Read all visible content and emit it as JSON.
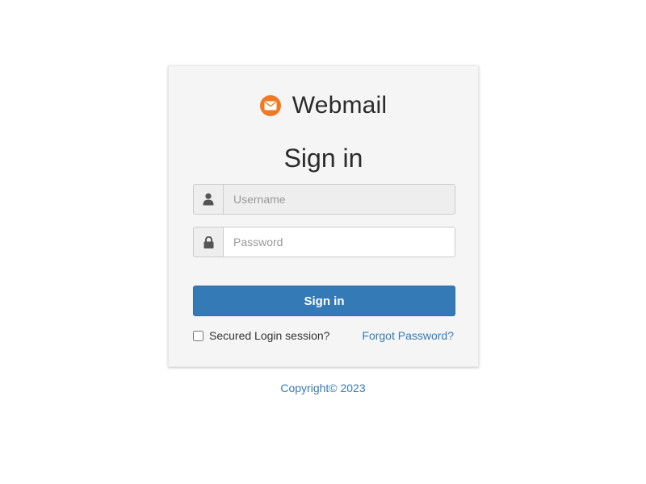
{
  "brand": {
    "name": "Webmail",
    "icon": "envelope-icon",
    "icon_color": "#f07a23"
  },
  "form": {
    "title": "Sign in",
    "username": {
      "icon": "user-icon",
      "placeholder": "Username",
      "value": ""
    },
    "password": {
      "icon": "lock-icon",
      "placeholder": "Password",
      "value": ""
    },
    "submit_label": "Sign in",
    "submit_color": "#337ab7",
    "secure_session_label": "Secured Login session?",
    "secure_session_checked": false,
    "forgot_password_label": "Forgot Password?"
  },
  "footer": {
    "copyright": "Copyright© 2023"
  }
}
